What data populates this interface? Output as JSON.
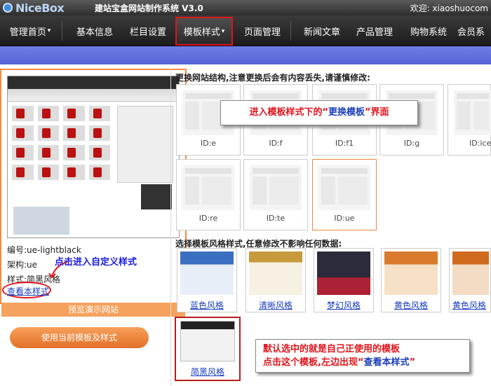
{
  "topbar": {
    "logo": "NiceBox",
    "system_title": "建站宝盒网站制作系统 V3.0",
    "welcome": "欢迎: xiaoshuocom"
  },
  "nav": {
    "items": [
      {
        "label": "管理首页",
        "caret": "▾"
      },
      {
        "label": "基本信息"
      },
      {
        "label": "栏目设置"
      },
      {
        "label": "模板样式",
        "caret": "▾",
        "active": true
      },
      {
        "label": "页面管理"
      },
      {
        "label": "新闻文章"
      },
      {
        "label": "产品管理"
      },
      {
        "label": "购物系统"
      },
      {
        "label": "会员系"
      }
    ]
  },
  "current_template": {
    "id_text": "编号:ue-lightblack",
    "arch_text": "架构:ue",
    "style_text": "样式:简黑风格",
    "view_style_link": "查看本样式",
    "preview_site_button": "预览演示网站",
    "use_button": "使用当前模板及样式"
  },
  "structure_section": {
    "title": "更换网站结构,注意更换后会有内容丢失,请谨慎修改:",
    "templates": [
      {
        "label": "ID:e"
      },
      {
        "label": "ID:f"
      },
      {
        "label": "ID:f1"
      },
      {
        "label": "ID:g"
      },
      {
        "label": "ID:ice"
      },
      {
        "label": "ID:re"
      },
      {
        "label": "ID:te"
      },
      {
        "label": "ID:ue",
        "selected": true
      }
    ]
  },
  "style_section": {
    "title": "选择模板风格样式,任意修改不影响任何数据:",
    "styles": [
      {
        "label": "蓝色风格",
        "color": "#3a6fc2"
      },
      {
        "label": "清晰风格",
        "color": "#c79a3c"
      },
      {
        "label": "梦幻风格",
        "color": "#2b2b3b"
      },
      {
        "label": "黄色风格",
        "color": "#d97a2c"
      },
      {
        "label": "黄色风格",
        "color": "#d06a1e"
      }
    ],
    "selected_style": {
      "label": "简黑风格"
    }
  },
  "annotations": {
    "template_change": {
      "prefix": "进入模板样式下的“",
      "highlight": "更换模板",
      "suffix": "”界面"
    },
    "custom_style": "点击进入自定义样式",
    "selected_note_line1": "默认选中的就是自己正使用的模板",
    "selected_note_line2_prefix": "点击这个模板,左边出现“",
    "selected_note_line2_highlight": "查看本样式",
    "selected_note_line2_suffix": "”"
  },
  "colors": {
    "accent_orange": "#f58a3c",
    "highlight_red": "#e0141b",
    "link_blue": "#1a3dbd",
    "nav_bg": "#2a2a2a",
    "blue_bar": "#5f6ddf"
  }
}
